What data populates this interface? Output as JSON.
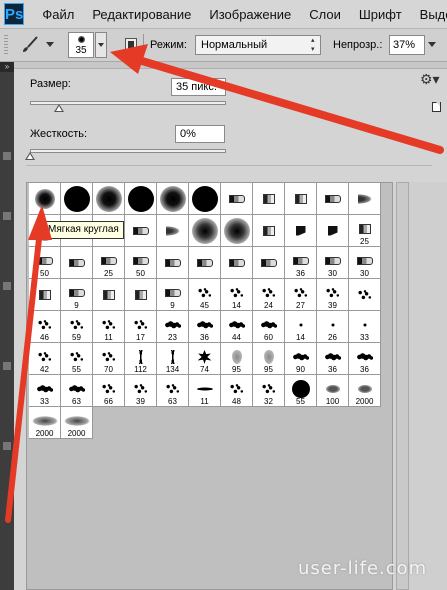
{
  "menubar": {
    "logo": "Ps",
    "items": [
      "Файл",
      "Редактирование",
      "Изображение",
      "Слои",
      "Шрифт",
      "Выделе"
    ]
  },
  "options": {
    "tool_icon": "brush-icon",
    "brush_size": "35",
    "mode_label": "Режим:",
    "mode_value": "Нормальный",
    "opacity_label": "Непрозр.:",
    "opacity_value": "37%"
  },
  "picker": {
    "size_label": "Размер:",
    "size_value": "35 пикс.",
    "size_slider": 0.15,
    "hardness_label": "Жесткость:",
    "hardness_value": "0%",
    "hardness_slider": 0.0,
    "tooltip": "Мягкая круглая",
    "gear_icon": "gear-icon",
    "new_preset_icon": "new-preset-icon"
  },
  "brushes": [
    [
      {
        "t": "soft",
        "s": 20,
        "n": ""
      },
      {
        "t": "hard",
        "s": 26,
        "n": ""
      },
      {
        "t": "soft",
        "s": 26,
        "n": ""
      },
      {
        "t": "hard",
        "s": 26,
        "n": ""
      },
      {
        "t": "soft",
        "s": 26,
        "n": ""
      },
      {
        "t": "hard",
        "s": 26,
        "n": ""
      },
      {
        "t": "lipstick",
        "n": ""
      },
      {
        "t": "bristle",
        "n": ""
      },
      {
        "t": "bristle",
        "n": ""
      },
      {
        "t": "lipstick",
        "n": ""
      },
      {
        "t": "fan",
        "n": ""
      }
    ],
    [
      {
        "t": "soft",
        "s": 20,
        "n": ""
      },
      {
        "t": "lipstick",
        "n": ""
      },
      {
        "t": "lipstick",
        "n": ""
      },
      {
        "t": "lipstick",
        "n": ""
      },
      {
        "t": "fan",
        "n": ""
      },
      {
        "t": "soft-big",
        "n": ""
      },
      {
        "t": "soft-big",
        "n": ""
      },
      {
        "t": "bristle",
        "n": ""
      },
      {
        "t": "blade",
        "n": ""
      },
      {
        "t": "blade",
        "n": ""
      },
      {
        "t": "bristle",
        "n": "25"
      }
    ],
    [
      {
        "t": "lipstick",
        "n": "50"
      },
      {
        "t": "lipstick",
        "n": ""
      },
      {
        "t": "lipstick",
        "n": "25"
      },
      {
        "t": "lipstick",
        "n": "50"
      },
      {
        "t": "lipstick",
        "n": ""
      },
      {
        "t": "lipstick",
        "n": ""
      },
      {
        "t": "lipstick",
        "n": ""
      },
      {
        "t": "lipstick",
        "n": ""
      },
      {
        "t": "lipstick",
        "n": "36"
      },
      {
        "t": "lipstick",
        "n": "30"
      },
      {
        "t": "lipstick",
        "n": "30"
      }
    ],
    [
      {
        "t": "bristle",
        "n": ""
      },
      {
        "t": "lipstick",
        "n": "9"
      },
      {
        "t": "bristle",
        "n": ""
      },
      {
        "t": "bristle",
        "n": ""
      },
      {
        "t": "lipstick",
        "n": "9"
      },
      {
        "t": "spatter",
        "n": "45"
      },
      {
        "t": "spatter",
        "n": "14"
      },
      {
        "t": "spatter",
        "n": "24"
      },
      {
        "t": "spatter",
        "n": "27"
      },
      {
        "t": "spatter",
        "n": "39"
      },
      {
        "t": "spatter",
        "n": ""
      }
    ],
    [
      {
        "t": "spatter",
        "n": "46"
      },
      {
        "t": "spatter",
        "n": "59"
      },
      {
        "t": "spatter",
        "n": "11"
      },
      {
        "t": "spatter",
        "n": "17"
      },
      {
        "t": "ink",
        "n": "23"
      },
      {
        "t": "ink",
        "n": "36"
      },
      {
        "t": "ink",
        "n": "44"
      },
      {
        "t": "ink",
        "n": "60"
      },
      {
        "t": "dot",
        "n": "14"
      },
      {
        "t": "dot",
        "n": "26"
      },
      {
        "t": "dot",
        "n": "33"
      }
    ],
    [
      {
        "t": "spatter",
        "n": "42"
      },
      {
        "t": "spatter",
        "n": "55"
      },
      {
        "t": "spatter",
        "n": "70"
      },
      {
        "t": "grass",
        "n": "112"
      },
      {
        "t": "grass",
        "n": "134"
      },
      {
        "t": "leaf",
        "n": "74"
      },
      {
        "t": "drop",
        "n": "95"
      },
      {
        "t": "drop",
        "n": "95"
      },
      {
        "t": "ink",
        "n": "90"
      },
      {
        "t": "ink",
        "n": "36"
      },
      {
        "t": "ink",
        "n": "36"
      }
    ],
    [
      {
        "t": "ink",
        "n": "33"
      },
      {
        "t": "ink",
        "n": "63"
      },
      {
        "t": "spatter",
        "n": "66"
      },
      {
        "t": "spatter",
        "n": "39"
      },
      {
        "t": "spatter",
        "n": "63"
      },
      {
        "t": "stroke",
        "n": "11"
      },
      {
        "t": "spatter",
        "n": "48"
      },
      {
        "t": "spatter",
        "n": "32"
      },
      {
        "t": "hard-med",
        "n": "55"
      },
      {
        "t": "grain",
        "n": "100"
      },
      {
        "t": "grain",
        "n": "2000"
      }
    ],
    [
      {
        "t": "wide-soft",
        "n": "2000"
      },
      {
        "t": "wide-soft",
        "n": "2000"
      }
    ]
  ],
  "watermark": "user-life.com"
}
